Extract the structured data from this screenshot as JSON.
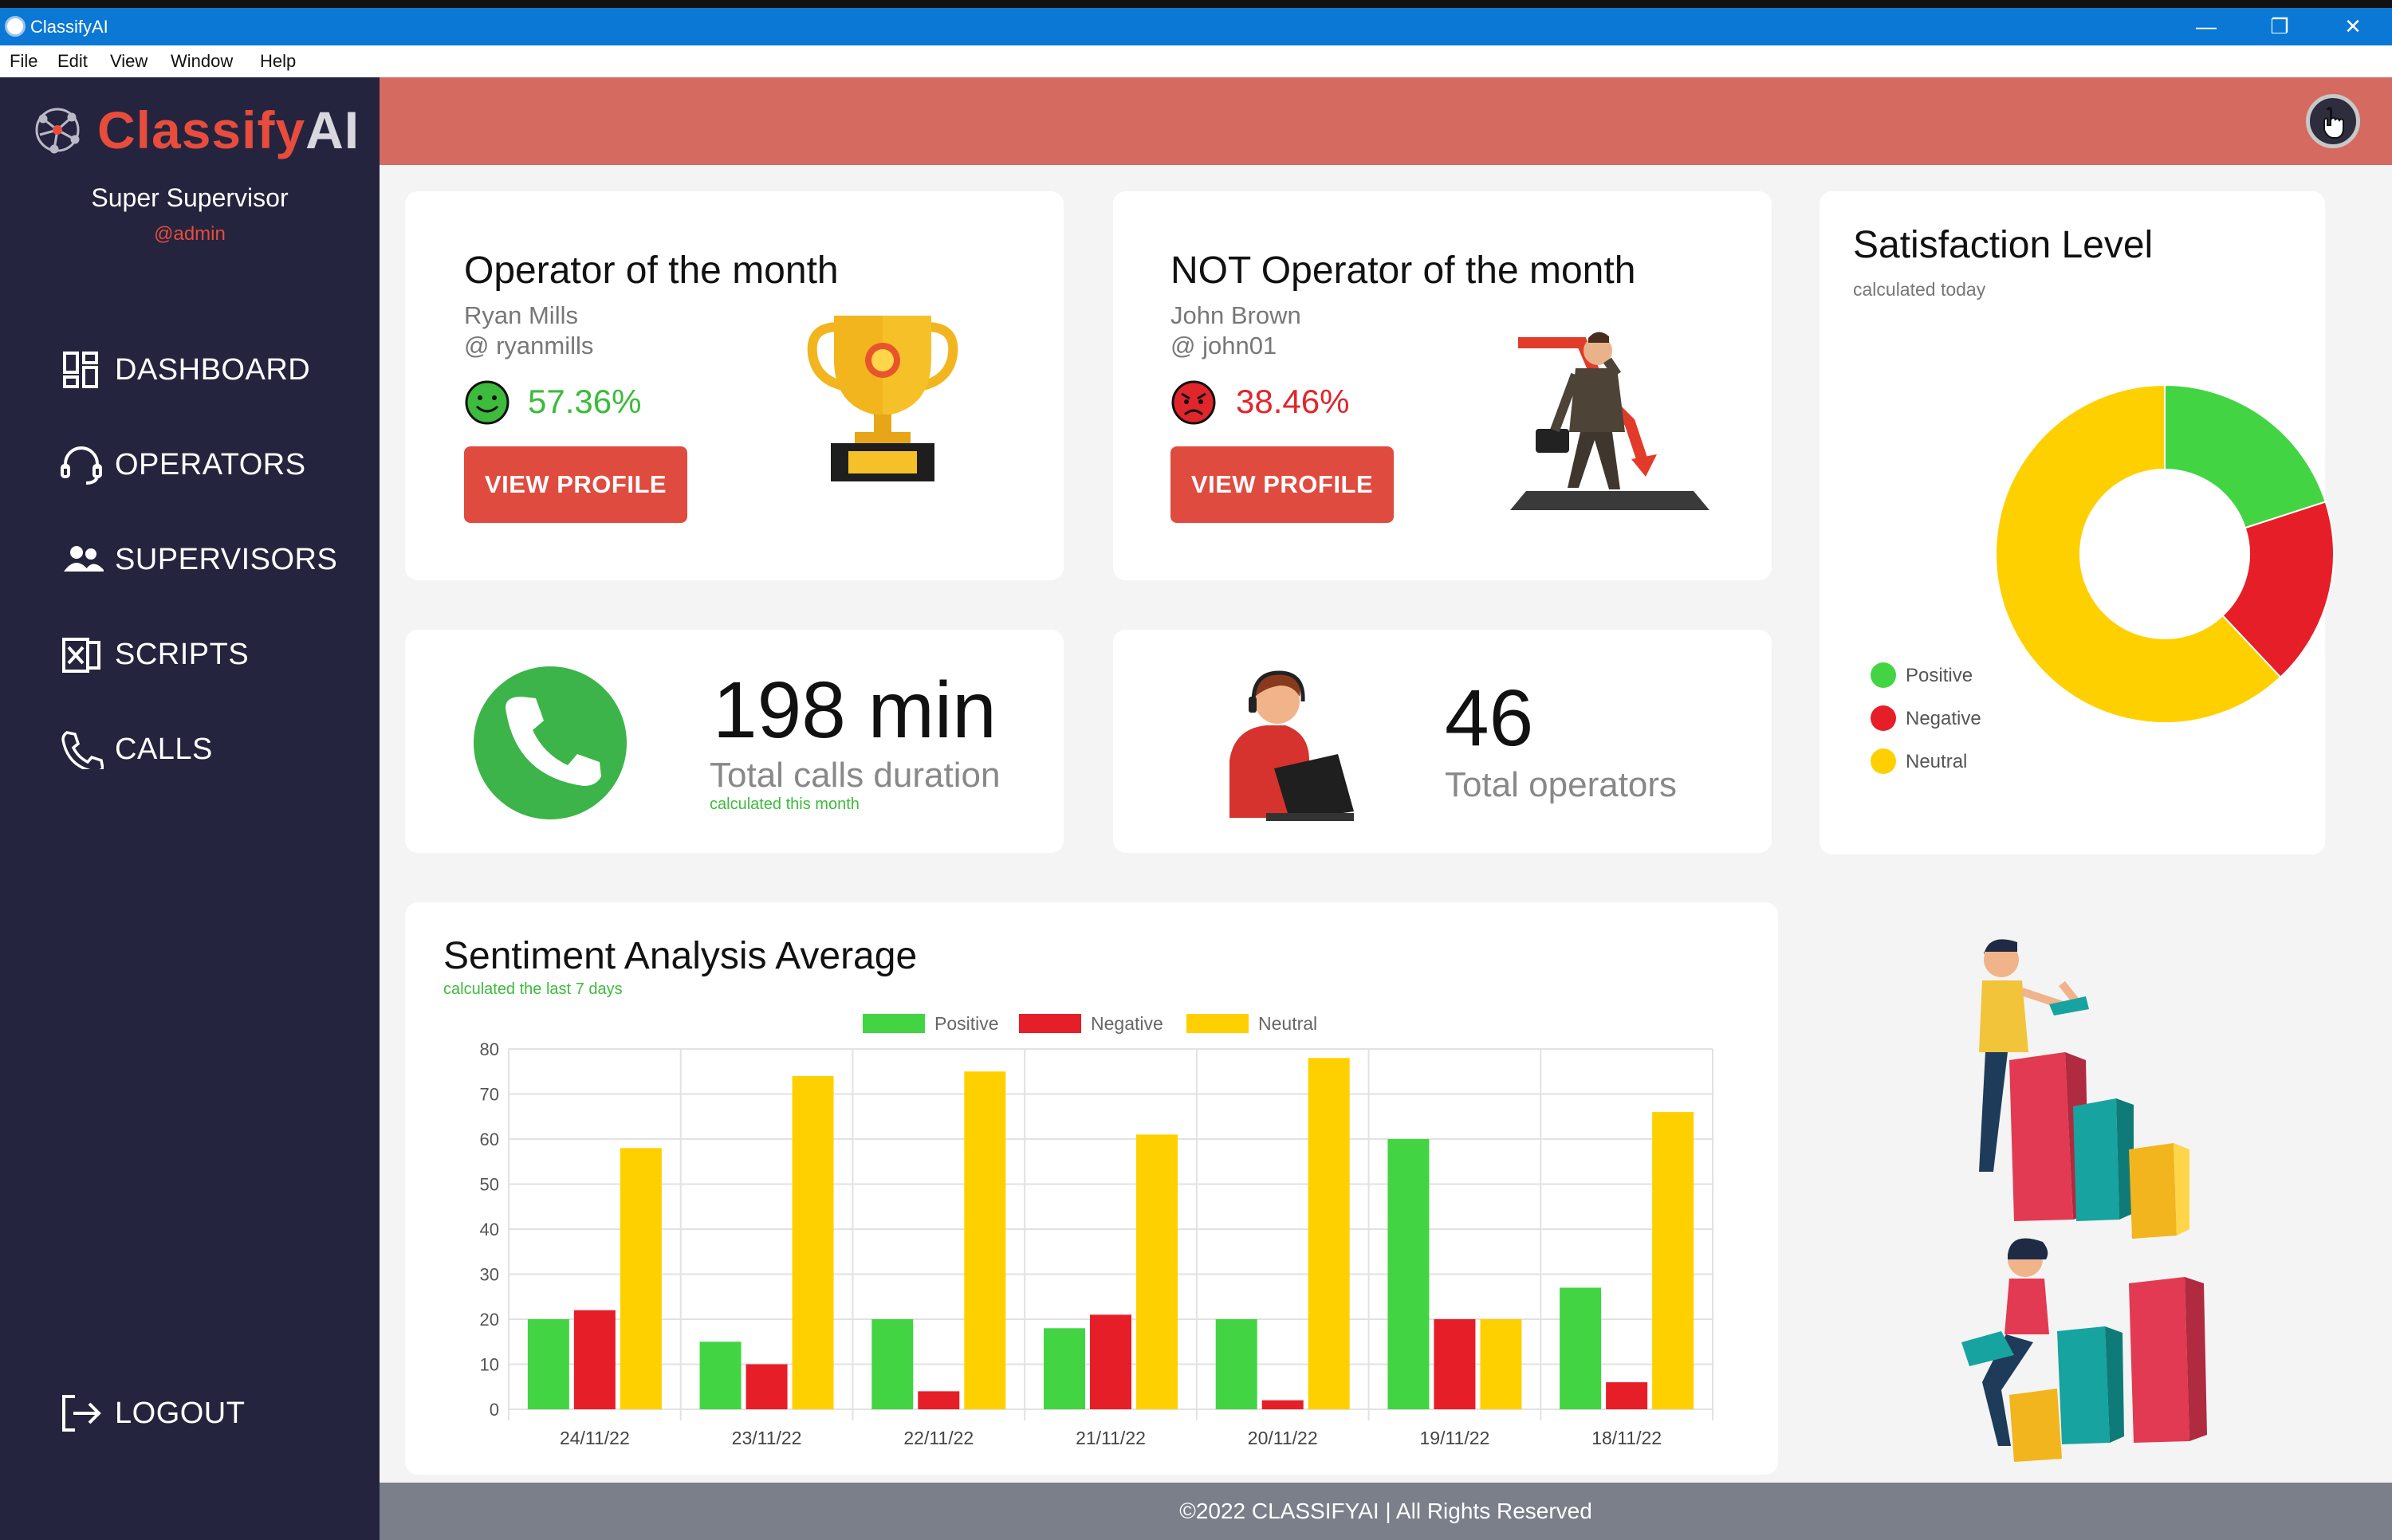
{
  "window": {
    "title": "ClassifyAI",
    "controls": [
      "—",
      "❐",
      "✕"
    ]
  },
  "menu": {
    "items": [
      "File",
      "Edit",
      "View",
      "Window",
      "Help"
    ]
  },
  "sidebar": {
    "logo_part1": "Classify",
    "logo_part2": "AI",
    "role": "Super Supervisor",
    "handle": "@admin",
    "nav": [
      {
        "label": "DASHBOARD",
        "icon": "dashboard-icon"
      },
      {
        "label": "OPERATORS",
        "icon": "headset-icon"
      },
      {
        "label": "SUPERVISORS",
        "icon": "users-icon"
      },
      {
        "label": "SCRIPTS",
        "icon": "excel-file-icon"
      },
      {
        "label": "CALLS",
        "icon": "phone-icon"
      }
    ],
    "logout": "LOGOUT"
  },
  "operator_best": {
    "title": "Operator of the month",
    "name": "Ryan Mills",
    "username": "@ ryanmills",
    "score": "57.36%",
    "button": "VIEW PROFILE",
    "color": "#3cbb3c"
  },
  "operator_worst": {
    "title": "NOT Operator of the month",
    "name": "John Brown",
    "username": "@ john01",
    "score": "38.46%",
    "button": "VIEW PROFILE",
    "color": "#e0262c"
  },
  "calls_duration": {
    "value": "198 min",
    "caption": "Total calls duration",
    "note": "calculated this month"
  },
  "operators_total": {
    "value": "46",
    "caption": "Total operators"
  },
  "satisfaction": {
    "title": "Satisfaction Level",
    "note": "calculated today",
    "legend": [
      "Positive",
      "Negative",
      "Neutral"
    ]
  },
  "sentiment": {
    "title": "Sentiment Analysis Average",
    "note": "calculated the last 7 days"
  },
  "footer": {
    "text": "©2022 CLASSIFYAI | All Rights Reserved"
  },
  "colors": {
    "positive": "#43d443",
    "negative": "#e61e28",
    "neutral": "#ffd000",
    "accent": "#e04b3f",
    "sidebar": "#24243e"
  },
  "chart_data": [
    {
      "type": "pie",
      "labels": [
        "Positive",
        "Negative",
        "Neutral"
      ],
      "values": [
        20,
        18,
        62
      ]
    },
    {
      "type": "bar",
      "categories": [
        "24/11/22",
        "23/11/22",
        "22/11/22",
        "21/11/22",
        "20/11/22",
        "19/11/22",
        "18/11/22"
      ],
      "series": [
        {
          "name": "Positive",
          "values": [
            20,
            15,
            20,
            18,
            20,
            60,
            27
          ]
        },
        {
          "name": "Negative",
          "values": [
            22,
            10,
            4,
            21,
            2,
            20,
            6
          ]
        },
        {
          "name": "Neutral",
          "values": [
            58,
            74,
            75,
            61,
            78,
            20,
            66
          ]
        }
      ],
      "ylim": [
        0,
        80
      ],
      "yticks": [
        0,
        10,
        20,
        30,
        40,
        50,
        60,
        70,
        80
      ],
      "legend": "top-center",
      "grid": true
    }
  ]
}
